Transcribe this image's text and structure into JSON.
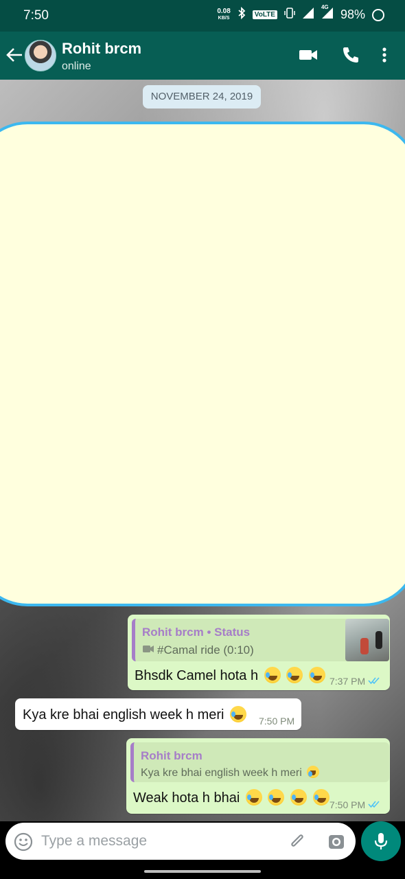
{
  "status_bar": {
    "time": "7:50",
    "net_speed_value": "0.08",
    "net_speed_unit": "KB/S",
    "volte": "VoLTE",
    "signal_label": "4G",
    "battery": "98%"
  },
  "header": {
    "name": "Rohit brcm",
    "status": "online"
  },
  "chat": {
    "date_chip": "NOVEMBER 24, 2019",
    "messages": [
      {
        "quote_name": "Rohit brcm • Status",
        "quote_text": "#Camal ride (0:10)",
        "text": "Bhsdk Camel hota h",
        "time": "7:37 PM"
      },
      {
        "text": "Kya kre bhai english week h meri",
        "time": "7:50 PM"
      },
      {
        "quote_name": "Rohit brcm",
        "quote_text": "Kya kre bhai english week h meri",
        "text": "Weak hota h bhai",
        "time": "7:50 PM"
      }
    ]
  },
  "input": {
    "placeholder": "Type a message"
  },
  "colors": {
    "header": "#075e54",
    "outgoing_bubble": "#dcf8c6",
    "incoming_bubble": "#ffffff",
    "accent": "#00897b",
    "read_ticks": "#4fc3f7"
  }
}
